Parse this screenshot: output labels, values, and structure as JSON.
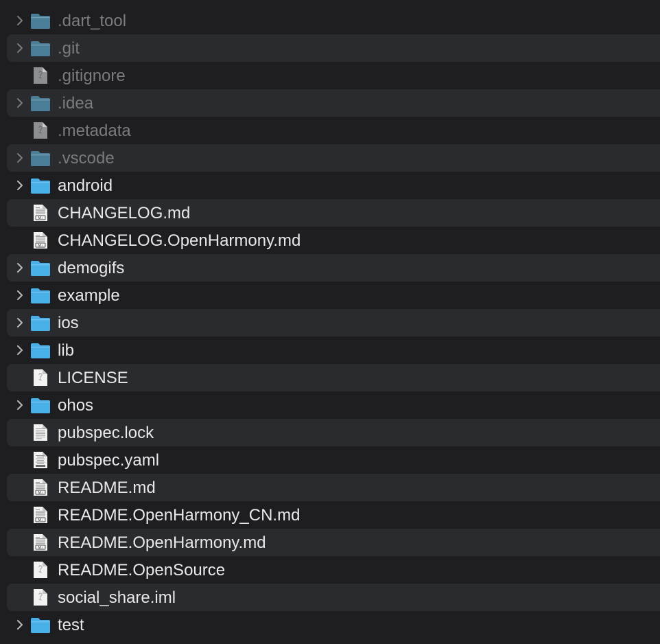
{
  "colors": {
    "background": "#1e1e20",
    "row_alt": "#2a2b2e",
    "text": "#e8e8ea",
    "text_hidden": "#7a7b7f",
    "folder": "#4ab1e8",
    "folder_hidden": "#4b7e98"
  },
  "items": [
    {
      "label": ".dart_tool",
      "type": "folder",
      "hidden": true,
      "icon": "folder-icon"
    },
    {
      "label": ".git",
      "type": "folder",
      "hidden": true,
      "icon": "folder-icon"
    },
    {
      "label": ".gitignore",
      "type": "file",
      "hidden": true,
      "icon": "generic-file-icon"
    },
    {
      "label": ".idea",
      "type": "folder",
      "hidden": true,
      "icon": "folder-icon"
    },
    {
      "label": ".metadata",
      "type": "file",
      "hidden": true,
      "icon": "generic-file-icon"
    },
    {
      "label": ".vscode",
      "type": "folder",
      "hidden": true,
      "icon": "folder-icon"
    },
    {
      "label": "android",
      "type": "folder",
      "hidden": false,
      "icon": "folder-icon"
    },
    {
      "label": "CHANGELOG.md",
      "type": "markdown",
      "hidden": false,
      "icon": "markdown-file-icon"
    },
    {
      "label": "CHANGELOG.OpenHarmony.md",
      "type": "markdown",
      "hidden": false,
      "icon": "markdown-file-icon"
    },
    {
      "label": "demogifs",
      "type": "folder",
      "hidden": false,
      "icon": "folder-icon"
    },
    {
      "label": "example",
      "type": "folder",
      "hidden": false,
      "icon": "folder-icon"
    },
    {
      "label": "ios",
      "type": "folder",
      "hidden": false,
      "icon": "folder-icon"
    },
    {
      "label": "lib",
      "type": "folder",
      "hidden": false,
      "icon": "folder-icon"
    },
    {
      "label": "LICENSE",
      "type": "file",
      "hidden": false,
      "icon": "generic-file-icon"
    },
    {
      "label": "ohos",
      "type": "folder",
      "hidden": false,
      "icon": "folder-icon"
    },
    {
      "label": "pubspec.lock",
      "type": "text",
      "hidden": false,
      "icon": "text-file-icon"
    },
    {
      "label": "pubspec.yaml",
      "type": "yaml",
      "hidden": false,
      "icon": "yaml-file-icon"
    },
    {
      "label": "README.md",
      "type": "markdown",
      "hidden": false,
      "icon": "markdown-file-icon"
    },
    {
      "label": "README.OpenHarmony_CN.md",
      "type": "markdown",
      "hidden": false,
      "icon": "markdown-file-icon"
    },
    {
      "label": "README.OpenHarmony.md",
      "type": "markdown",
      "hidden": false,
      "icon": "markdown-file-icon"
    },
    {
      "label": "README.OpenSource",
      "type": "file",
      "hidden": false,
      "icon": "generic-file-icon"
    },
    {
      "label": "social_share.iml",
      "type": "file",
      "hidden": false,
      "icon": "generic-file-icon"
    },
    {
      "label": "test",
      "type": "folder",
      "hidden": false,
      "icon": "folder-icon"
    }
  ]
}
